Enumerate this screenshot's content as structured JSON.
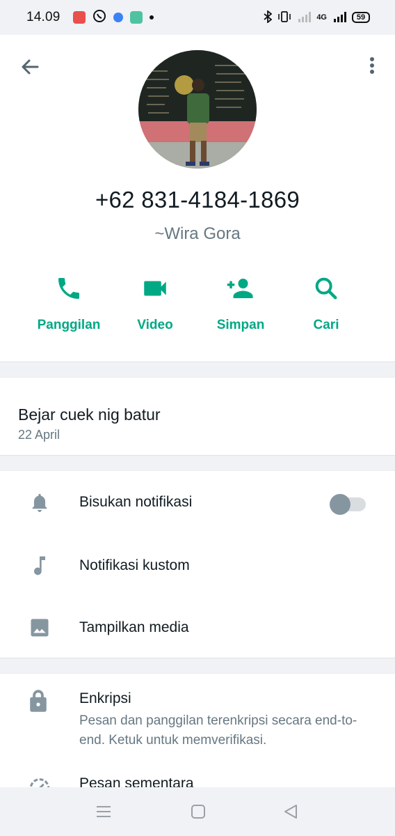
{
  "status_bar": {
    "time": "14.09",
    "network": "4G",
    "battery": "59"
  },
  "contact": {
    "phone": "+62 831-4184-1869",
    "pushname": "~Wira Gora"
  },
  "actions": [
    {
      "label": "Panggilan",
      "icon": "phone-icon"
    },
    {
      "label": "Video",
      "icon": "video-camera-icon"
    },
    {
      "label": "Simpan",
      "icon": "add-person-icon"
    },
    {
      "label": "Cari",
      "icon": "search-icon"
    }
  ],
  "about": {
    "text": "Bejar cuek nig batur",
    "date": "22 April"
  },
  "settings": [
    {
      "label": "Bisukan notifikasi",
      "icon": "bell-icon",
      "toggle_on": false
    },
    {
      "label": "Notifikasi kustom",
      "icon": "music-note-icon"
    },
    {
      "label": "Tampilkan media",
      "icon": "image-icon"
    }
  ],
  "encryption": {
    "title": "Enkripsi",
    "subtitle": "Pesan dan panggilan terenkripsi secara end-to-end. Ketuk untuk memverifikasi."
  },
  "disappearing": {
    "title": "Pesan sementara"
  },
  "colors": {
    "accent": "#00a884",
    "icon_gray": "#8696a0",
    "secondary_text": "#667781"
  }
}
